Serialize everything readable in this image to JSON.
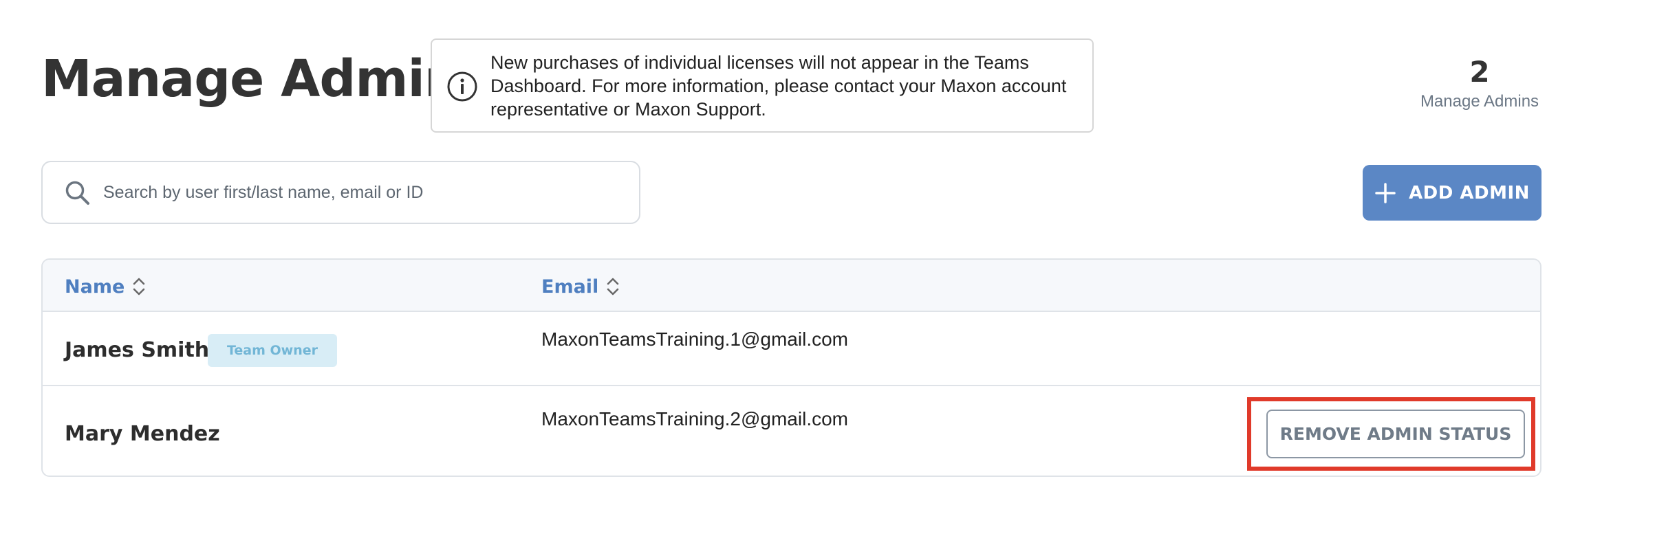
{
  "header": {
    "title": "Manage Admins",
    "notice": "New purchases of individual licenses will not appear in the Teams Dashboard. For more information, please contact your Maxon account representative or Maxon Support.",
    "stat": {
      "value": "2",
      "label": "Manage Admins"
    }
  },
  "search": {
    "placeholder": "Search by user first/last name, email or ID",
    "value": ""
  },
  "actions": {
    "add_admin_label": "ADD ADMIN"
  },
  "table": {
    "columns": [
      {
        "label": "Name"
      },
      {
        "label": "Email"
      }
    ],
    "rows": [
      {
        "name": "James Smith",
        "badge": "Team Owner",
        "email": "MaxonTeamsTraining.1@gmail.com"
      },
      {
        "name": "Mary Mendez",
        "email": "MaxonTeamsTraining.2@gmail.com",
        "action_label": "REMOVE ADMIN STATUS"
      }
    ]
  },
  "colors": {
    "accent": "#5b87c5",
    "header_link": "#4f7fc0",
    "badge_bg": "#d8edf6",
    "badge_text": "#72b6d6",
    "highlight": "#e03a2a"
  },
  "icons": {
    "notice": "info-icon",
    "search": "search-icon",
    "add": "plus-icon",
    "sort": "sort-icon"
  }
}
